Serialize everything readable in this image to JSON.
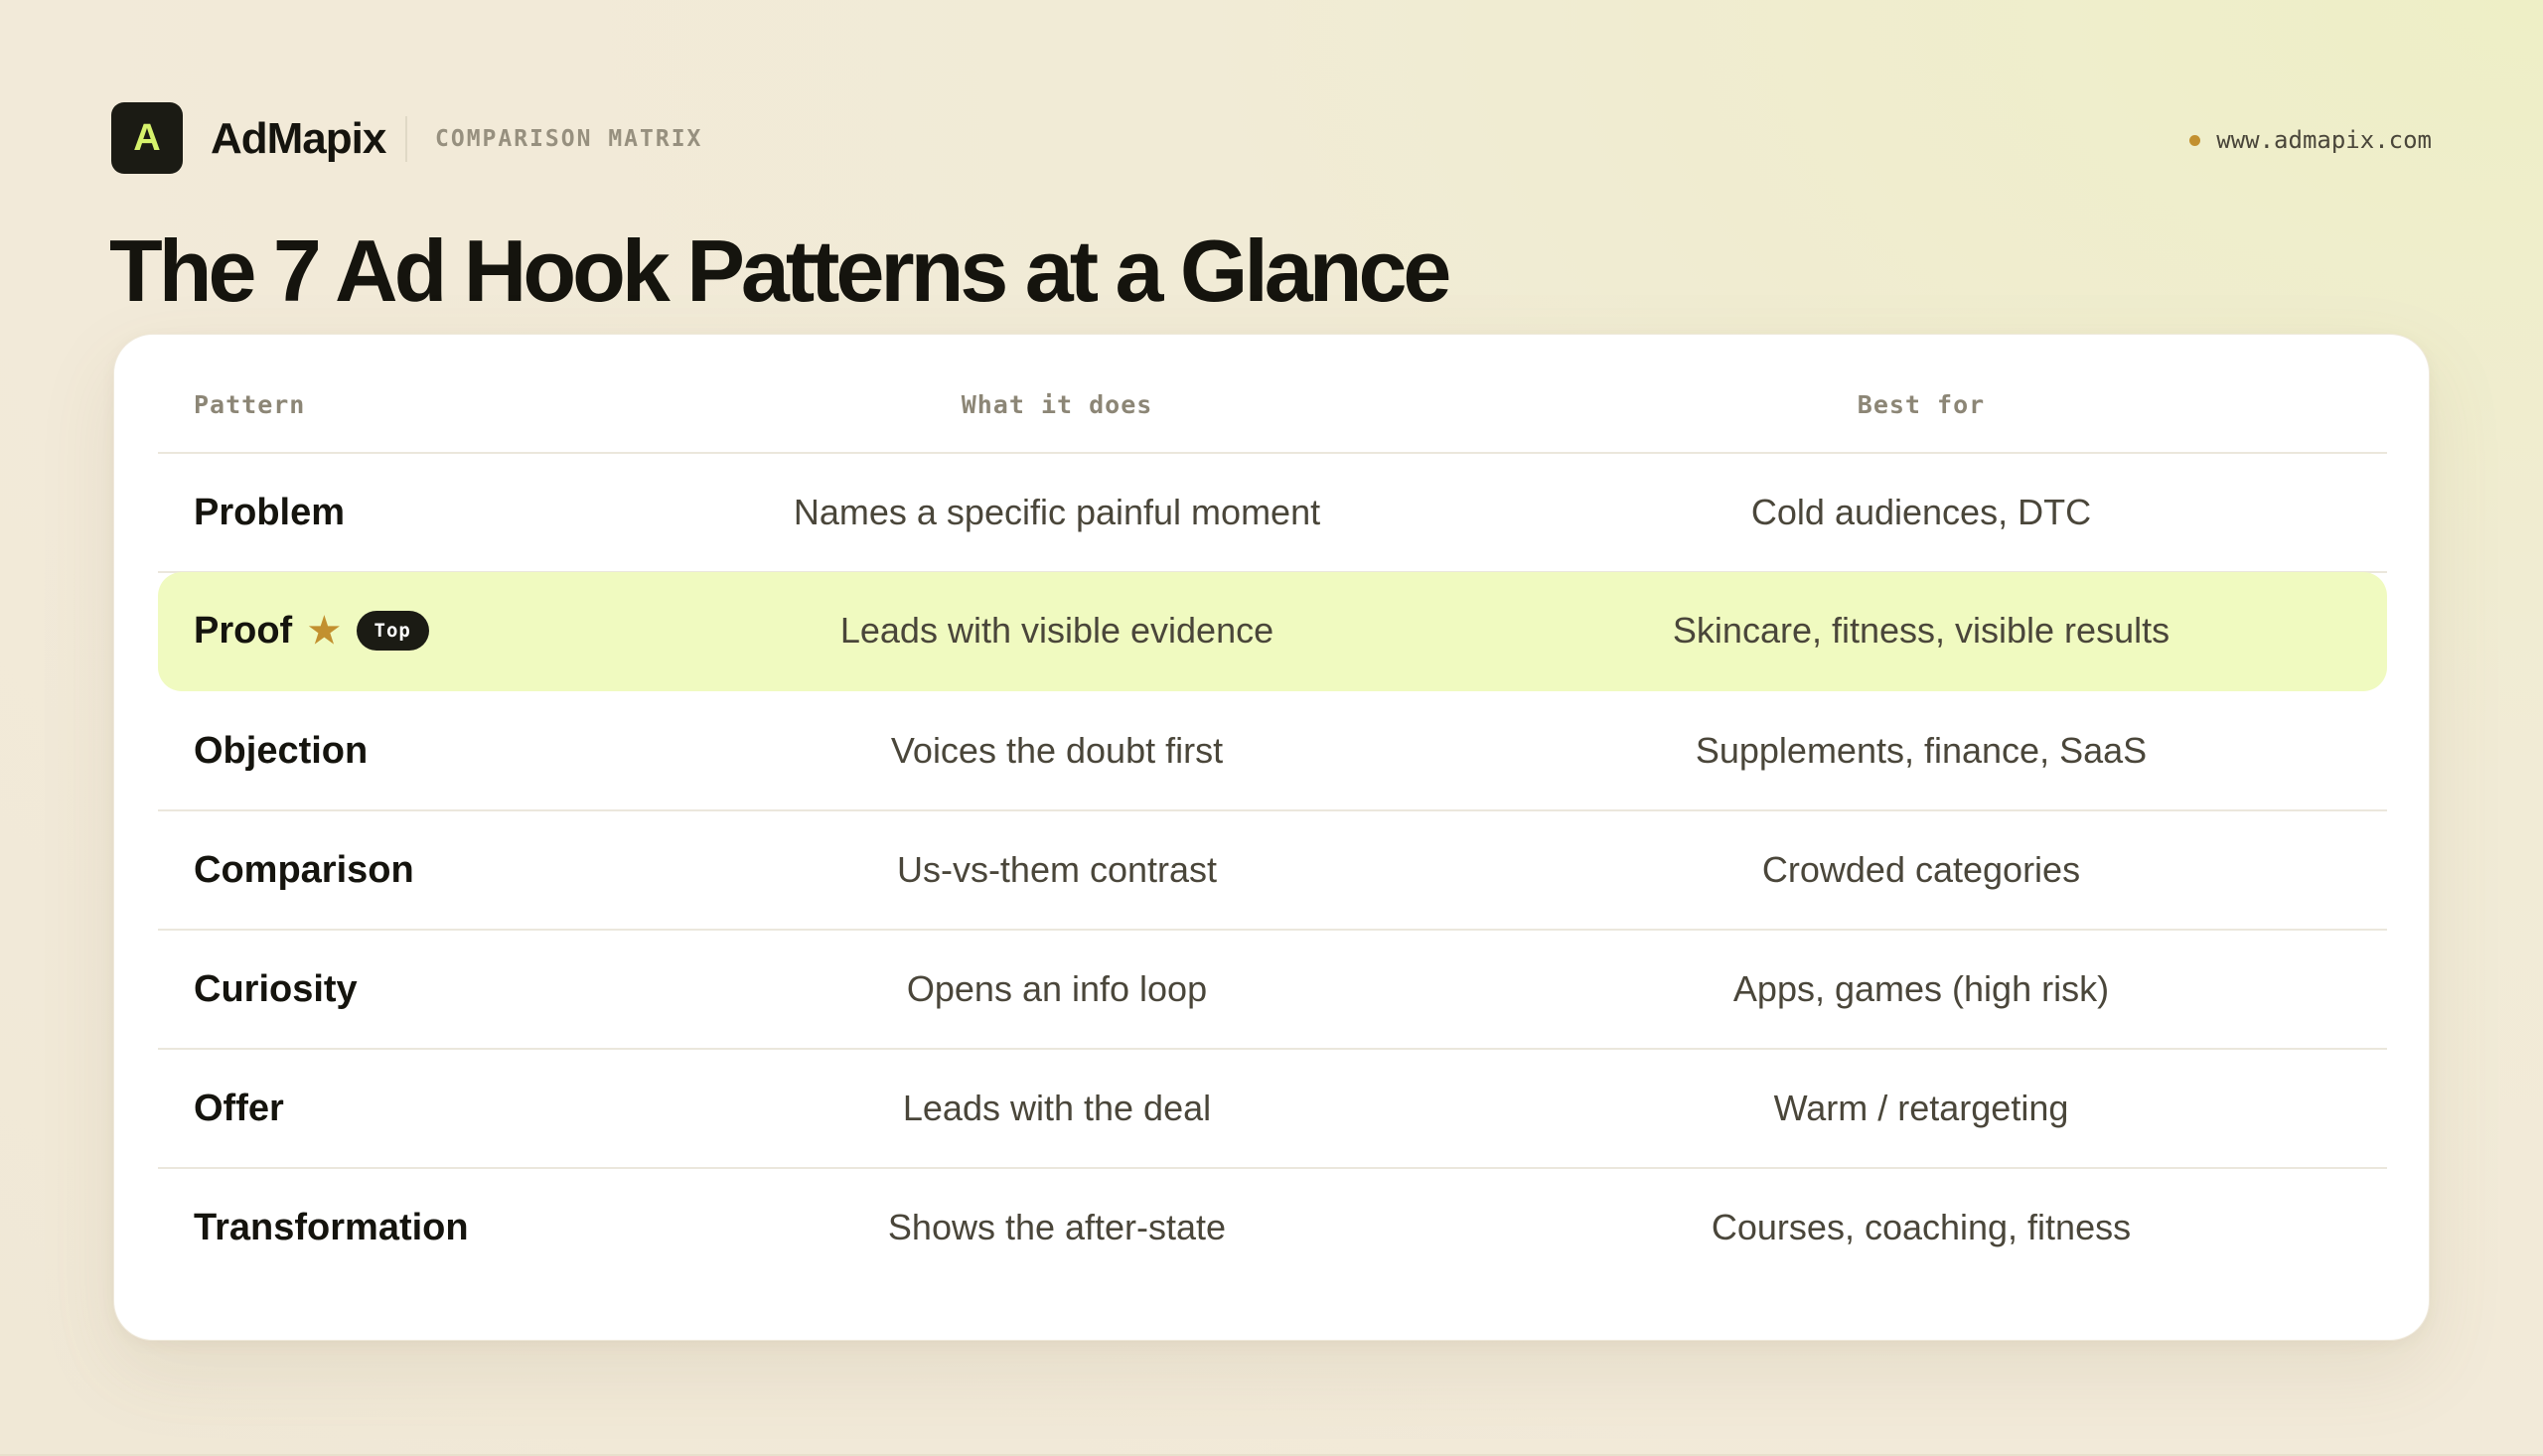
{
  "header": {
    "logo_letter": "A",
    "brand": "AdMapix",
    "section_label": "COMPARISON MATRIX",
    "site_url": "www.admapix.com"
  },
  "title": "The 7 Ad Hook Patterns at a Glance",
  "table": {
    "columns": [
      "Pattern",
      "What it does",
      "Best for"
    ],
    "rows": [
      {
        "pattern": "Problem",
        "what_it_does": "Names a specific painful moment",
        "best_for": "Cold audiences, DTC"
      },
      {
        "pattern": "Proof",
        "what_it_does": "Leads with visible evidence",
        "best_for": "Skincare, fitness, visible results",
        "badge": "Top",
        "starred": true
      },
      {
        "pattern": "Objection",
        "what_it_does": "Voices the doubt first",
        "best_for": "Supplements, finance, SaaS"
      },
      {
        "pattern": "Comparison",
        "what_it_does": "Us-vs-them contrast",
        "best_for": "Crowded categories"
      },
      {
        "pattern": "Curiosity",
        "what_it_does": "Opens an info loop",
        "best_for": "Apps, games (high risk)"
      },
      {
        "pattern": "Offer",
        "what_it_does": "Leads with the deal",
        "best_for": "Warm / retargeting"
      },
      {
        "pattern": "Transformation",
        "what_it_does": "Shows the after-state",
        "best_for": "Courses, coaching, fitness"
      }
    ]
  },
  "colors": {
    "accent_lime": "#d6f26c",
    "highlight_row": "#f0fac0",
    "star_gold": "#c2902f",
    "ink": "#15140e"
  },
  "icons": {
    "star": "star-icon",
    "url_dot": "dot-icon"
  }
}
